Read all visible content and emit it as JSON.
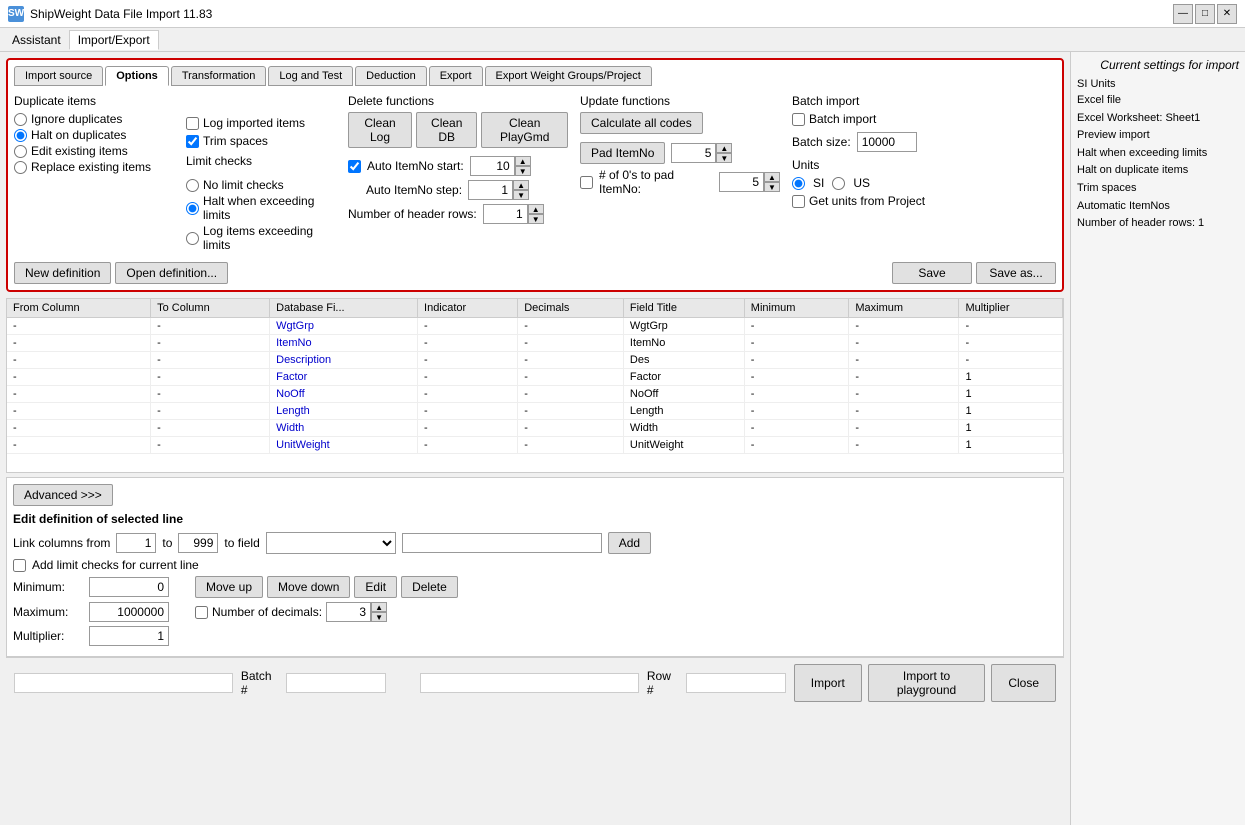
{
  "window": {
    "title": "ShipWeight Data File Import 11.83",
    "minimize": "—",
    "maximize": "□",
    "close": "✕"
  },
  "menu": {
    "items": [
      "Assistant",
      "Import/Export"
    ],
    "active": "Import/Export"
  },
  "right_sidebar": {
    "title": "Current settings for import",
    "section": "SI Units",
    "items": [
      "Excel file",
      "Excel Worksheet: Sheet1",
      "Preview import",
      "Halt when exceeding limits",
      "Halt on duplicate items",
      "Trim spaces",
      "Automatic ItemNos",
      "Number of header rows: 1"
    ]
  },
  "tabs": [
    "Import source",
    "Options",
    "Transformation",
    "Log and Test",
    "Deduction",
    "Export",
    "Export Weight Groups/Project"
  ],
  "active_tab": "Options",
  "duplicate_items": {
    "label": "Duplicate items",
    "options": [
      "Ignore duplicates",
      "Halt on duplicates",
      "Edit existing items",
      "Replace existing items"
    ],
    "selected": "Halt on duplicates"
  },
  "log_items": {
    "log_imported": {
      "label": "Log imported items",
      "checked": false
    },
    "trim_spaces": {
      "label": "Trim spaces",
      "checked": true
    }
  },
  "delete_functions": {
    "label": "Delete functions",
    "clean_log": "Clean Log",
    "clean_db": "Clean DB",
    "clean_playgmd": "Clean PlayGmd"
  },
  "auto_item": {
    "auto_itemno_start_checked": true,
    "auto_itemno_start_label": "Auto ItemNo start:",
    "auto_itemno_start_value": "10",
    "auto_itemno_step_label": "Auto ItemNo step:",
    "auto_itemno_step_value": "1",
    "header_rows_label": "Number of  header rows:",
    "header_rows_value": "1"
  },
  "update_functions": {
    "label": "Update functions",
    "calculate_all_codes": "Calculate all codes",
    "pad_itemno": "Pad ItemNo",
    "pad_value": "5"
  },
  "batch_import": {
    "label": "Batch import",
    "checked": false,
    "size_label": "Batch size:",
    "size_value": "10000"
  },
  "limit_checks": {
    "label": "Limit checks",
    "options": [
      "No limit checks",
      "Halt when exceeding limits",
      "Log items exceeding limits"
    ],
    "selected": "Halt when exceeding limits"
  },
  "pad_zeros": {
    "label": "# of 0's to pad ItemNo:",
    "value": "5"
  },
  "units": {
    "label": "Units",
    "options": [
      "SI",
      "US"
    ],
    "selected": "SI",
    "get_from_project_label": "Get units from Project",
    "get_from_project_checked": false
  },
  "bottom_definition_buttons": {
    "new_def": "New definition",
    "open_def": "Open definition...",
    "save": "Save",
    "save_as": "Save as..."
  },
  "table": {
    "headers": [
      "From Column",
      "To Column",
      "Database Fi...",
      "Indicator",
      "Decimals",
      "Field Title",
      "Minimum",
      "Maximum",
      "Multiplier"
    ],
    "rows": [
      {
        "from": "-",
        "to": "-",
        "db": "WgtGrp",
        "indicator": "-",
        "decimals": "-",
        "title": "WgtGrp",
        "min": "-",
        "max": "-",
        "mult": "-"
      },
      {
        "from": "-",
        "to": "-",
        "db": "ItemNo",
        "indicator": "-",
        "decimals": "-",
        "title": "ItemNo",
        "min": "-",
        "max": "-",
        "mult": "-"
      },
      {
        "from": "-",
        "to": "-",
        "db": "Description",
        "indicator": "-",
        "decimals": "-",
        "title": "Des",
        "min": "-",
        "max": "-",
        "mult": "-"
      },
      {
        "from": "-",
        "to": "-",
        "db": "Factor",
        "indicator": "-",
        "decimals": "-",
        "title": "Factor",
        "min": "-",
        "max": "-",
        "mult": "1"
      },
      {
        "from": "-",
        "to": "-",
        "db": "NoOff",
        "indicator": "-",
        "decimals": "-",
        "title": "NoOff",
        "min": "-",
        "max": "-",
        "mult": "1"
      },
      {
        "from": "-",
        "to": "-",
        "db": "Length",
        "indicator": "-",
        "decimals": "-",
        "title": "Length",
        "min": "-",
        "max": "-",
        "mult": "1"
      },
      {
        "from": "-",
        "to": "-",
        "db": "Width",
        "indicator": "-",
        "decimals": "-",
        "title": "Width",
        "min": "-",
        "max": "-",
        "mult": "1"
      },
      {
        "from": "-",
        "to": "-",
        "db": "UnitWeight",
        "indicator": "-",
        "decimals": "-",
        "title": "UnitWeight",
        "min": "-",
        "max": "-",
        "mult": "1"
      }
    ]
  },
  "advanced": {
    "btn_label": "Advanced >>>",
    "edit_def_label": "Edit definition of selected line",
    "link_cols_label": "Link columns from",
    "link_from": "1",
    "link_to": "999",
    "to_field_label": "to field",
    "add_limit_checks_label": "Add limit checks for current line",
    "minimum_label": "Minimum:",
    "minimum_value": "0",
    "maximum_label": "Maximum:",
    "maximum_value": "1000000",
    "multiplier_label": "Multiplier:",
    "multiplier_value": "1",
    "move_up": "Move up",
    "move_down": "Move down",
    "edit": "Edit",
    "delete": "Delete",
    "add": "Add",
    "number_of_decimals_label": "Number of decimals:",
    "number_of_decimals_checked": false,
    "number_of_decimals_value": "3"
  },
  "bottom_bar": {
    "input1_value": "",
    "batch_label": "Batch #",
    "batch_value": "",
    "row_label": "Row #",
    "row_value": "",
    "import_btn": "Import",
    "import_playground_btn": "Import to playground",
    "close_btn": "Close"
  }
}
